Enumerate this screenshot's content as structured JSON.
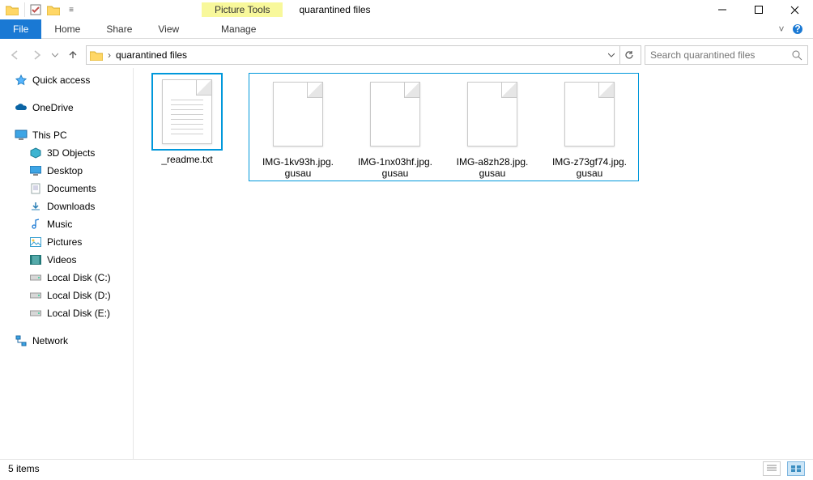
{
  "window": {
    "tools_label": "Picture Tools",
    "title": "quarantined files"
  },
  "ribbon": {
    "file": "File",
    "home": "Home",
    "share": "Share",
    "view": "View",
    "manage": "Manage"
  },
  "address": {
    "path": "quarantined files",
    "search_placeholder": "Search quarantined files"
  },
  "sidebar": {
    "quick_access": "Quick access",
    "onedrive": "OneDrive",
    "this_pc": "This PC",
    "objects3d": "3D Objects",
    "desktop": "Desktop",
    "documents": "Documents",
    "downloads": "Downloads",
    "music": "Music",
    "pictures": "Pictures",
    "videos": "Videos",
    "disk_c": "Local Disk (C:)",
    "disk_d": "Local Disk (D:)",
    "disk_e": "Local Disk (E:)",
    "network": "Network"
  },
  "files": {
    "f0": "_readme.txt",
    "f1_l1": "IMG-1kv93h.jpg.",
    "f1_l2": "gusau",
    "f2_l1": "IMG-1nx03hf.jpg.",
    "f2_l2": "gusau",
    "f3_l1": "IMG-a8zh28.jpg.",
    "f3_l2": "gusau",
    "f4_l1": "IMG-z73gf74.jpg.",
    "f4_l2": "gusau"
  },
  "status": {
    "count": "5 items"
  }
}
